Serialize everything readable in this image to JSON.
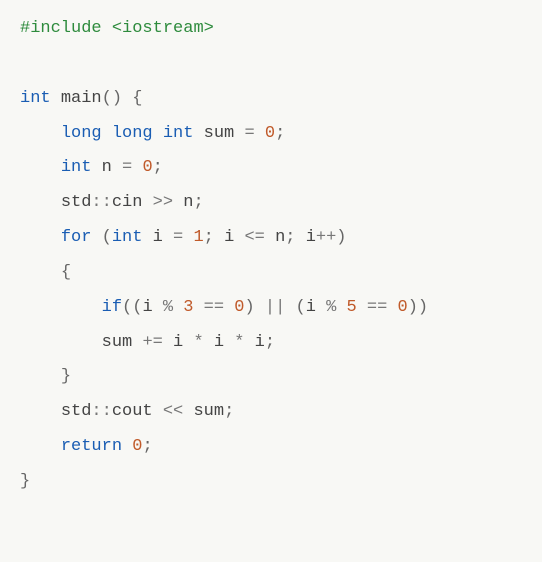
{
  "code": {
    "lines": [
      {
        "indent": 0,
        "tokens": [
          {
            "cls": "preproc",
            "text": "#include "
          },
          {
            "cls": "preproc",
            "text": "<iostream>"
          }
        ]
      },
      {
        "indent": 0,
        "tokens": [
          {
            "cls": "plain",
            "text": " "
          }
        ]
      },
      {
        "indent": 0,
        "tokens": [
          {
            "cls": "type",
            "text": "int"
          },
          {
            "cls": "plain",
            "text": " "
          },
          {
            "cls": "ident",
            "text": "main"
          },
          {
            "cls": "punct",
            "text": "()"
          },
          {
            "cls": "plain",
            "text": " "
          },
          {
            "cls": "punct",
            "text": "{"
          }
        ]
      },
      {
        "indent": 1,
        "tokens": [
          {
            "cls": "type",
            "text": "long long int"
          },
          {
            "cls": "plain",
            "text": " "
          },
          {
            "cls": "ident",
            "text": "sum"
          },
          {
            "cls": "plain",
            "text": " "
          },
          {
            "cls": "op",
            "text": "="
          },
          {
            "cls": "plain",
            "text": " "
          },
          {
            "cls": "num",
            "text": "0"
          },
          {
            "cls": "punct",
            "text": ";"
          }
        ]
      },
      {
        "indent": 1,
        "tokens": [
          {
            "cls": "type",
            "text": "int"
          },
          {
            "cls": "plain",
            "text": " "
          },
          {
            "cls": "ident",
            "text": "n"
          },
          {
            "cls": "plain",
            "text": " "
          },
          {
            "cls": "op",
            "text": "="
          },
          {
            "cls": "plain",
            "text": " "
          },
          {
            "cls": "num",
            "text": "0"
          },
          {
            "cls": "punct",
            "text": ";"
          }
        ]
      },
      {
        "indent": 1,
        "tokens": [
          {
            "cls": "ident",
            "text": "std"
          },
          {
            "cls": "op",
            "text": "::"
          },
          {
            "cls": "ident",
            "text": "cin"
          },
          {
            "cls": "plain",
            "text": " "
          },
          {
            "cls": "op",
            "text": ">>"
          },
          {
            "cls": "plain",
            "text": " "
          },
          {
            "cls": "ident",
            "text": "n"
          },
          {
            "cls": "punct",
            "text": ";"
          }
        ]
      },
      {
        "indent": 1,
        "tokens": [
          {
            "cls": "keyword",
            "text": "for"
          },
          {
            "cls": "plain",
            "text": " "
          },
          {
            "cls": "punct",
            "text": "("
          },
          {
            "cls": "type",
            "text": "int"
          },
          {
            "cls": "plain",
            "text": " "
          },
          {
            "cls": "ident",
            "text": "i"
          },
          {
            "cls": "plain",
            "text": " "
          },
          {
            "cls": "op",
            "text": "="
          },
          {
            "cls": "plain",
            "text": " "
          },
          {
            "cls": "num",
            "text": "1"
          },
          {
            "cls": "punct",
            "text": ";"
          },
          {
            "cls": "plain",
            "text": " "
          },
          {
            "cls": "ident",
            "text": "i"
          },
          {
            "cls": "plain",
            "text": " "
          },
          {
            "cls": "op",
            "text": "<="
          },
          {
            "cls": "plain",
            "text": " "
          },
          {
            "cls": "ident",
            "text": "n"
          },
          {
            "cls": "punct",
            "text": ";"
          },
          {
            "cls": "plain",
            "text": " "
          },
          {
            "cls": "ident",
            "text": "i"
          },
          {
            "cls": "op",
            "text": "++"
          },
          {
            "cls": "punct",
            "text": ")"
          }
        ]
      },
      {
        "indent": 1,
        "tokens": [
          {
            "cls": "punct",
            "text": "{"
          }
        ]
      },
      {
        "indent": 2,
        "tokens": [
          {
            "cls": "keyword",
            "text": "if"
          },
          {
            "cls": "punct",
            "text": "(("
          },
          {
            "cls": "ident",
            "text": "i"
          },
          {
            "cls": "plain",
            "text": " "
          },
          {
            "cls": "op",
            "text": "%"
          },
          {
            "cls": "plain",
            "text": " "
          },
          {
            "cls": "num",
            "text": "3"
          },
          {
            "cls": "plain",
            "text": " "
          },
          {
            "cls": "op",
            "text": "=="
          },
          {
            "cls": "plain",
            "text": " "
          },
          {
            "cls": "num",
            "text": "0"
          },
          {
            "cls": "punct",
            "text": ")"
          },
          {
            "cls": "plain",
            "text": " "
          },
          {
            "cls": "op",
            "text": "||"
          },
          {
            "cls": "plain",
            "text": " "
          },
          {
            "cls": "punct",
            "text": "("
          },
          {
            "cls": "ident",
            "text": "i"
          },
          {
            "cls": "plain",
            "text": " "
          },
          {
            "cls": "op",
            "text": "%"
          },
          {
            "cls": "plain",
            "text": " "
          },
          {
            "cls": "num",
            "text": "5"
          },
          {
            "cls": "plain",
            "text": " "
          },
          {
            "cls": "op",
            "text": "=="
          },
          {
            "cls": "plain",
            "text": " "
          },
          {
            "cls": "num",
            "text": "0"
          },
          {
            "cls": "punct",
            "text": "))"
          }
        ]
      },
      {
        "indent": 2,
        "tokens": [
          {
            "cls": "ident",
            "text": "sum"
          },
          {
            "cls": "plain",
            "text": " "
          },
          {
            "cls": "op",
            "text": "+="
          },
          {
            "cls": "plain",
            "text": " "
          },
          {
            "cls": "ident",
            "text": "i"
          },
          {
            "cls": "plain",
            "text": " "
          },
          {
            "cls": "op",
            "text": "*"
          },
          {
            "cls": "plain",
            "text": " "
          },
          {
            "cls": "ident",
            "text": "i"
          },
          {
            "cls": "plain",
            "text": " "
          },
          {
            "cls": "op",
            "text": "*"
          },
          {
            "cls": "plain",
            "text": " "
          },
          {
            "cls": "ident",
            "text": "i"
          },
          {
            "cls": "punct",
            "text": ";"
          }
        ]
      },
      {
        "indent": 1,
        "tokens": [
          {
            "cls": "punct",
            "text": "}"
          }
        ]
      },
      {
        "indent": 1,
        "tokens": [
          {
            "cls": "ident",
            "text": "std"
          },
          {
            "cls": "op",
            "text": "::"
          },
          {
            "cls": "ident",
            "text": "cout"
          },
          {
            "cls": "plain",
            "text": " "
          },
          {
            "cls": "op",
            "text": "<<"
          },
          {
            "cls": "plain",
            "text": " "
          },
          {
            "cls": "ident",
            "text": "sum"
          },
          {
            "cls": "punct",
            "text": ";"
          }
        ]
      },
      {
        "indent": 1,
        "tokens": [
          {
            "cls": "keyword",
            "text": "return"
          },
          {
            "cls": "plain",
            "text": " "
          },
          {
            "cls": "num",
            "text": "0"
          },
          {
            "cls": "punct",
            "text": ";"
          }
        ]
      },
      {
        "indent": 0,
        "tokens": [
          {
            "cls": "punct",
            "text": "}"
          }
        ]
      }
    ]
  }
}
